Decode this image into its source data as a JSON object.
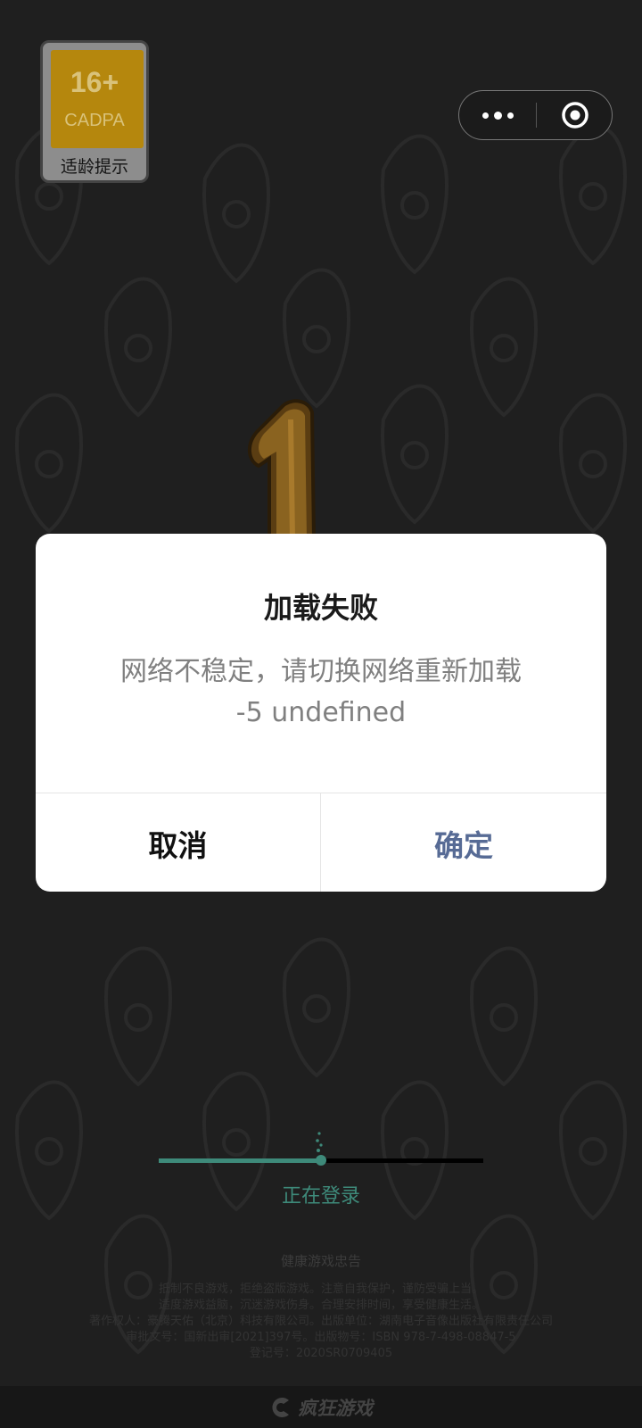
{
  "age_badge": {
    "age": "16+",
    "org": "CADPA",
    "tip": "适龄提示"
  },
  "capsule": {
    "more_icon": "more-dots-icon",
    "close_icon": "target-close-icon"
  },
  "dialog": {
    "title": "加载失败",
    "message_line1": "网络不稳定，请切换网络重新加载",
    "message_line2": "-5 undefined",
    "cancel_label": "取消",
    "confirm_label": "确定",
    "confirm_color": "#576b95"
  },
  "loading": {
    "status": "正在登录",
    "progress_percent": 50,
    "accent_color": "#3e8a7a"
  },
  "notice": {
    "title": "健康游戏忠告",
    "lines": [
      "抵制不良游戏，拒绝盗版游戏。注意自我保护，谨防受骗上当。",
      "适度游戏益脑，沉迷游戏伤身。合理安排时间，享受健康生活。",
      "著作权人：豪腾天佑（北京）科技有限公司。出版单位：湖南电子音像出版社有限责任公司",
      "审批文号：国新出审[2021]397号。出版物号：ISBN 978-7-498-08847-5",
      "登记号：2020SR0709405"
    ]
  },
  "brand": {
    "name": "疯狂游戏",
    "logo_icon": "crazy-game-logo-icon"
  }
}
